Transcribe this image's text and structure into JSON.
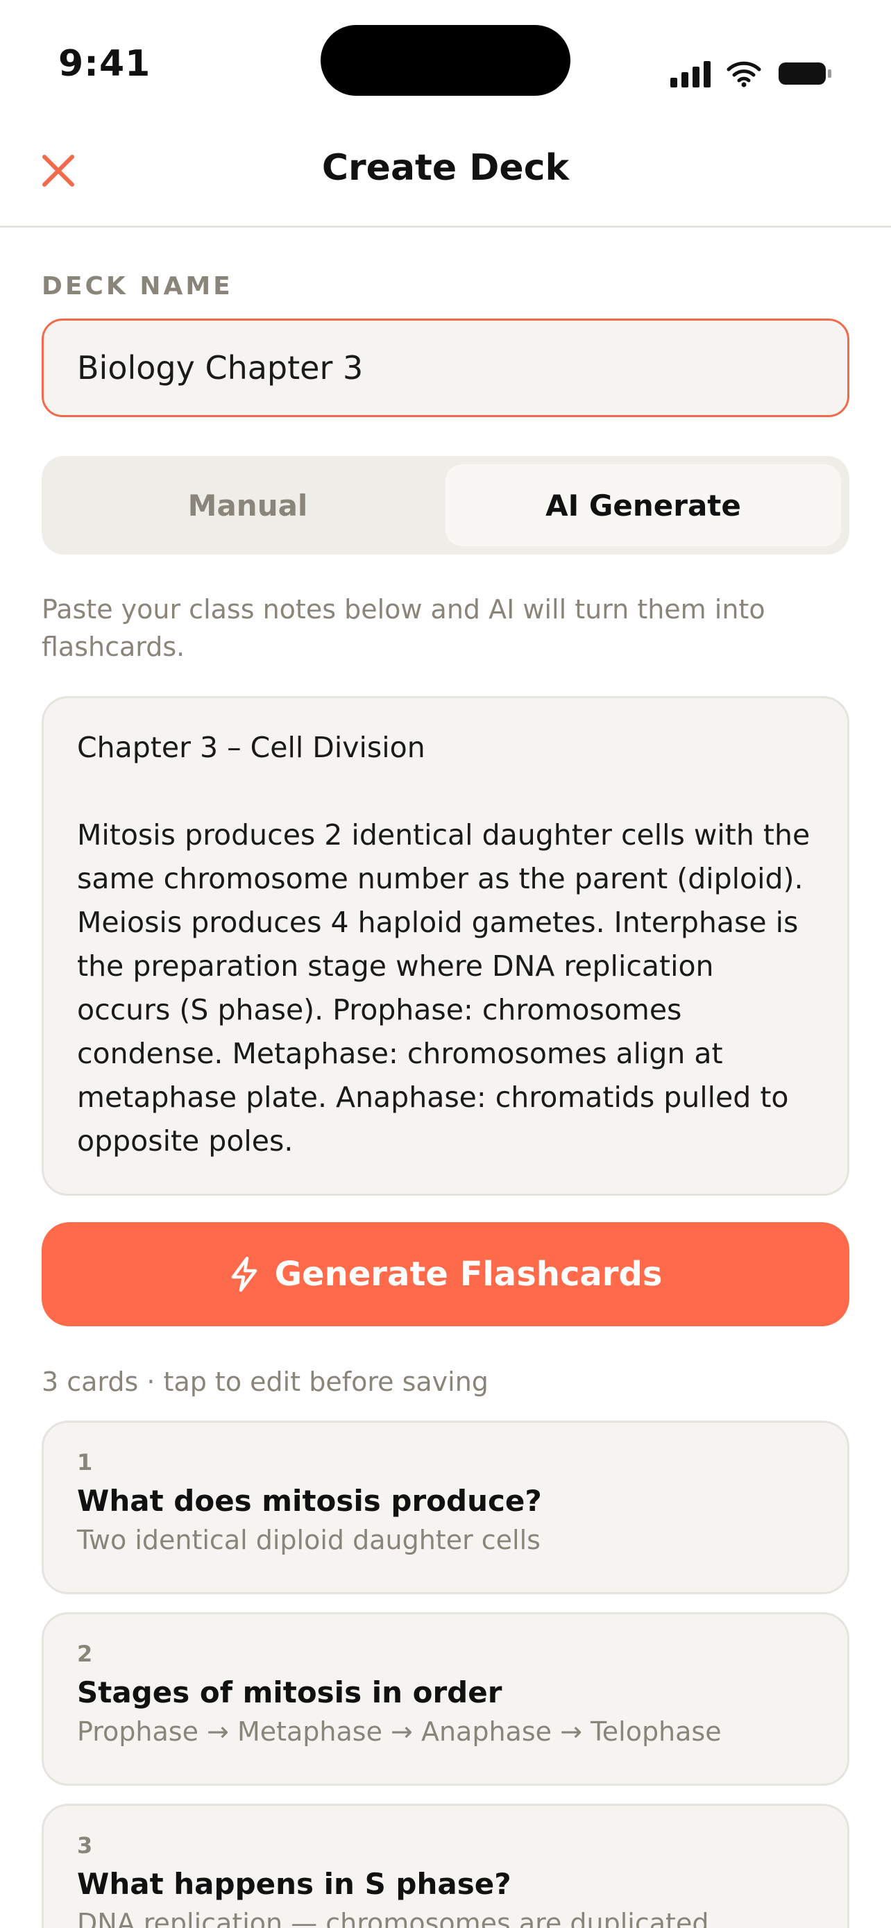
{
  "status_bar": {
    "time": "9:41"
  },
  "nav": {
    "title": "Create Deck"
  },
  "deck_name": {
    "label": "DECK NAME",
    "value": "Biology Chapter 3"
  },
  "mode_toggle": {
    "options": [
      "Manual",
      "AI Generate"
    ],
    "selected": "AI Generate"
  },
  "helper_text": "Paste your class notes below and AI will turn them into flashcards.",
  "notes": {
    "value": "Chapter 3 – Cell Division\n\nMitosis produces 2 identical daughter cells with the same chromosome number as the parent (diploid). Meiosis produces 4 haploid gametes. Interphase is the preparation stage where DNA replication occurs (S phase). Prophase: chromosomes condense. Metaphase: chromosomes align at metaphase plate. Anaphase: chromatids pulled to opposite poles."
  },
  "generate_button": {
    "label": "Generate Flashcards",
    "icon": "lightning-icon"
  },
  "cards_meta": "3 cards · tap to edit before saving",
  "cards": [
    {
      "number": "1",
      "question": "What does mitosis produce?",
      "answer": "Two identical diploid daughter cells"
    },
    {
      "number": "2",
      "question": "Stages of mitosis in order",
      "answer": "Prophase → Metaphase → Anaphase → Telophase"
    },
    {
      "number": "3",
      "question": "What happens in S phase?",
      "answer": "DNA replication — chromosomes are duplicated"
    }
  ],
  "colors": {
    "accent": "#ff6b4a",
    "input_border": "#f06a4b",
    "muted_text": "#8a857a",
    "surface": "#f6f4f0"
  }
}
